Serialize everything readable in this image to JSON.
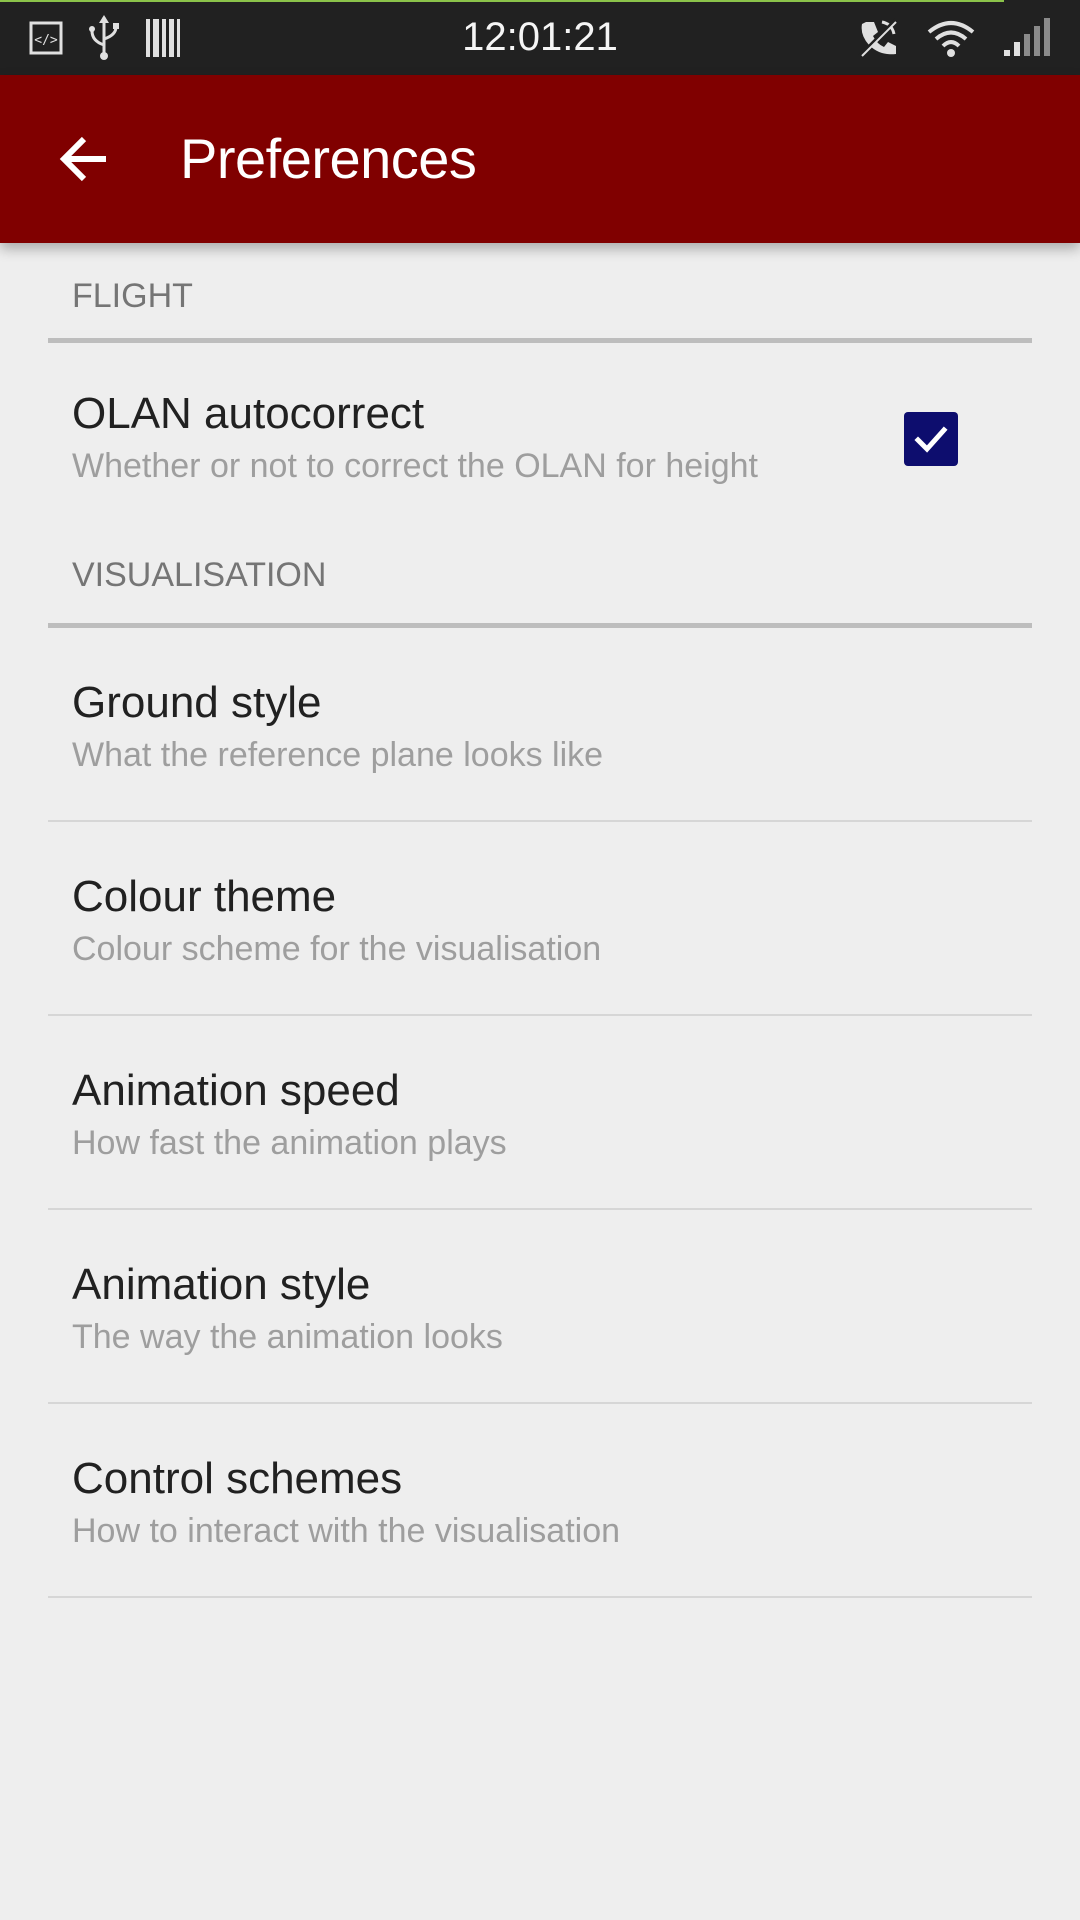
{
  "status_bar": {
    "time": "12:01:21",
    "left_icons": [
      "code-icon",
      "usb-icon",
      "barcode-icon"
    ],
    "right_icons": [
      "phone-silent-icon",
      "wifi-icon",
      "cell-signal-icon"
    ]
  },
  "app_bar": {
    "back_icon": "arrow-back-icon",
    "title": "Preferences",
    "background": "#800000"
  },
  "categories": [
    {
      "title": "FLIGHT",
      "items": [
        {
          "title": "OLAN autocorrect",
          "summary": "Whether or not to correct the OLAN for height",
          "checkbox": true
        }
      ]
    },
    {
      "title": "VISUALISATION",
      "items": [
        {
          "title": "Ground style",
          "summary": "What the reference plane looks like"
        },
        {
          "title": "Colour theme",
          "summary": "Colour scheme for the visualisation"
        },
        {
          "title": "Animation speed",
          "summary": "How fast the animation plays"
        },
        {
          "title": "Animation style",
          "summary": "The way the animation looks"
        },
        {
          "title": "Control schemes",
          "summary": "How to interact with the visualisation"
        }
      ]
    }
  ],
  "colors": {
    "checkbox": "#0d0d6e",
    "status_bar": "#212121"
  }
}
